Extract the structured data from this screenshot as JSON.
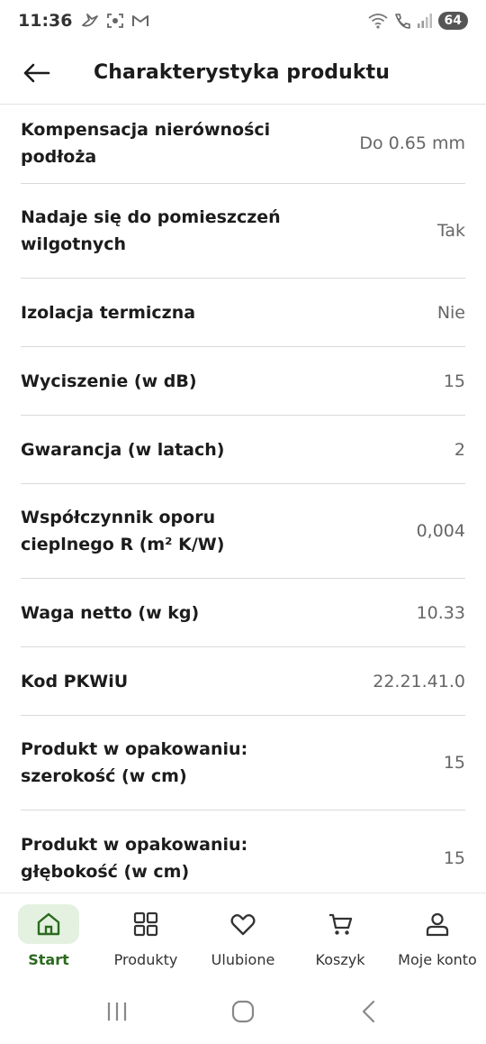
{
  "status_bar": {
    "time": "11:36",
    "battery": "64",
    "left_icons": [
      "bird-icon",
      "screenshot-icon",
      "gmail-icon"
    ],
    "right_icons": [
      "wifi-icon",
      "call-icon",
      "signal-icon"
    ]
  },
  "header": {
    "title": "Charakterystyka produktu",
    "back_icon": "arrow-left-icon"
  },
  "specs": [
    {
      "label": "Kompensacja nierówności podłoża",
      "value": "Do 0.65 mm"
    },
    {
      "label": "Nadaje się do pomieszczeń wilgotnych",
      "value": "Tak"
    },
    {
      "label": "Izolacja termiczna",
      "value": "Nie"
    },
    {
      "label": "Wyciszenie (w dB)",
      "value": "15"
    },
    {
      "label": "Gwarancja (w latach)",
      "value": "2"
    },
    {
      "label": "Współczynnik oporu cieplnego R (m² K/W)",
      "value": "0,004"
    },
    {
      "label": "Waga netto (w kg)",
      "value": "10.33"
    },
    {
      "label": "Kod PKWiU",
      "value": "22.21.41.0"
    },
    {
      "label": "Produkt w opakowaniu: szerokość (w cm)",
      "value": "15"
    },
    {
      "label": "Produkt w opakowaniu: głębokość (w cm)",
      "value": "15"
    }
  ],
  "bottom_nav": [
    {
      "label": "Start",
      "icon": "home-icon",
      "active": true
    },
    {
      "label": "Produkty",
      "icon": "grid-icon",
      "active": false
    },
    {
      "label": "Ulubione",
      "icon": "heart-icon",
      "active": false
    },
    {
      "label": "Koszyk",
      "icon": "cart-icon",
      "active": false
    },
    {
      "label": "Moje konto",
      "icon": "user-icon",
      "active": false
    }
  ],
  "colors": {
    "accent_green": "#2b6a1f",
    "active_bg": "#e4f1e0",
    "divider": "#d9d9d9",
    "value_text": "#666666"
  }
}
